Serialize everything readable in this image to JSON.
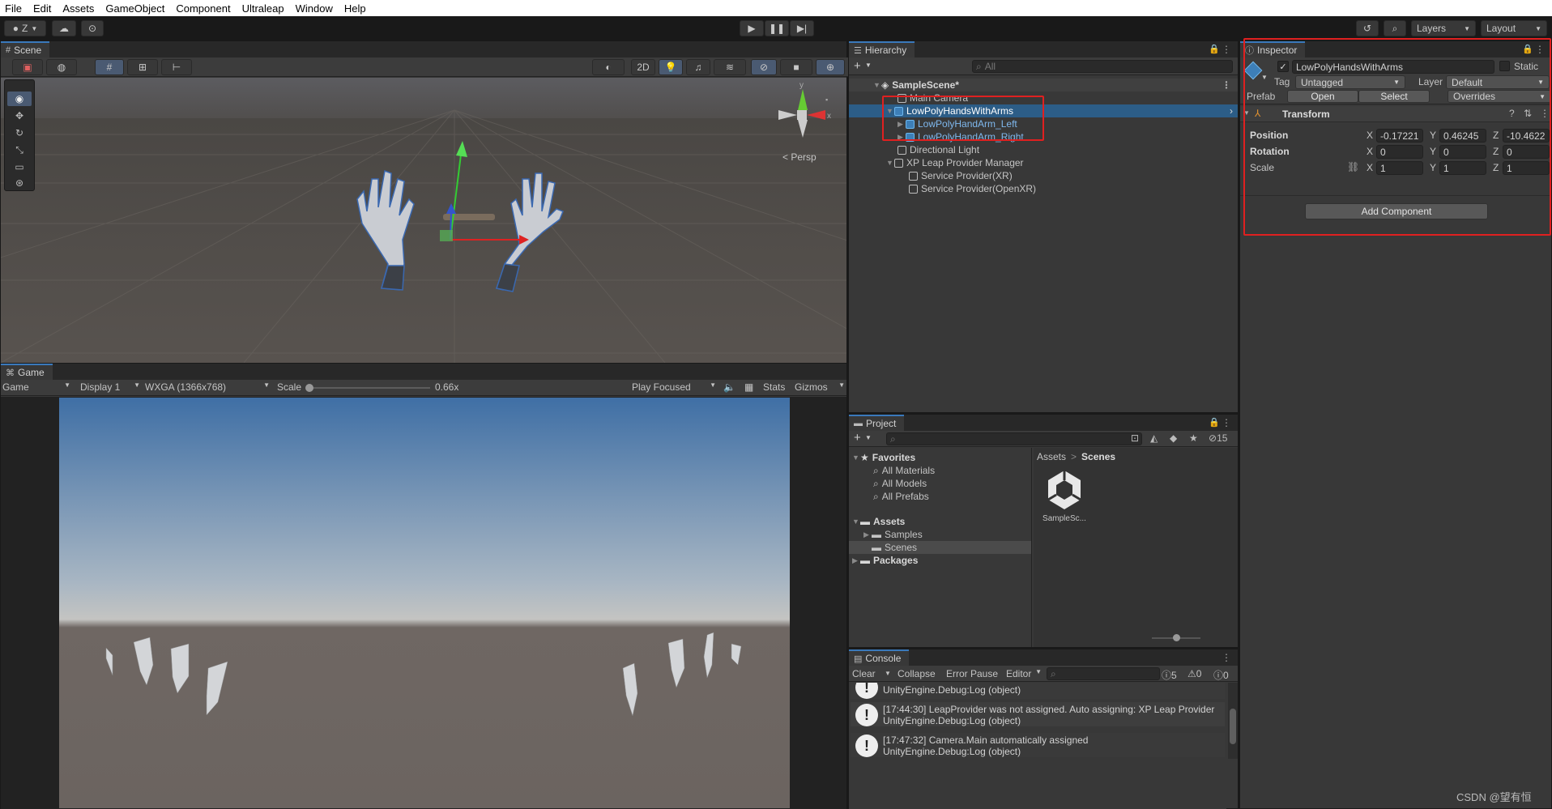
{
  "menu": [
    "File",
    "Edit",
    "Assets",
    "GameObject",
    "Component",
    "Ultraleap",
    "Window",
    "Help"
  ],
  "toolbar": {
    "account_label": "Z",
    "layers_label": "Layers",
    "layout_label": "Layout"
  },
  "scene": {
    "tab_label": "Scene",
    "persp_label": "< Persp",
    "view_2d": "2D",
    "gizmo_axes": {
      "x": "x",
      "y": "y"
    }
  },
  "game": {
    "tab_label": "Game",
    "game_dropdown": "Game",
    "display": "Display 1",
    "resolution": "WXGA (1366x768)",
    "scale_label": "Scale",
    "scale_value": "0.66x",
    "scale_fraction": 0.0,
    "play_focused": "Play Focused",
    "stats": "Stats",
    "gizmos": "Gizmos"
  },
  "hierarchy": {
    "tab_label": "Hierarchy",
    "search_placeholder": "All",
    "items": [
      {
        "label": "SampleScene*",
        "depth": 0,
        "type": "scene"
      },
      {
        "label": "Main Camera",
        "depth": 1,
        "type": "object"
      },
      {
        "label": "LowPolyHandsWithArms",
        "depth": 1,
        "type": "prefab",
        "selected": true
      },
      {
        "label": "LowPolyHandArm_Left",
        "depth": 2,
        "type": "prefab"
      },
      {
        "label": "LowPolyHandArm_Right",
        "depth": 2,
        "type": "prefab"
      },
      {
        "label": "Directional Light",
        "depth": 1,
        "type": "object"
      },
      {
        "label": "XP Leap Provider Manager",
        "depth": 1,
        "type": "object"
      },
      {
        "label": "Service Provider(XR)",
        "depth": 2,
        "type": "object"
      },
      {
        "label": "Service Provider(OpenXR)",
        "depth": 2,
        "type": "object"
      }
    ]
  },
  "inspector": {
    "tab_label": "Inspector",
    "object_name": "LowPolyHandsWithArms",
    "static_label": "Static",
    "tag_label": "Tag",
    "tag_value": "Untagged",
    "layer_label": "Layer",
    "layer_value": "Default",
    "prefab_label": "Prefab",
    "open_label": "Open",
    "select_label": "Select",
    "overrides_label": "Overrides",
    "transform_label": "Transform",
    "position_label": "Position",
    "pos_x": "-0.17221",
    "pos_y": "0.46245",
    "pos_z": "-10.4622",
    "rotation_label": "Rotation",
    "rot_x": "0",
    "rot_y": "0",
    "rot_z": "0",
    "scale_label": "Scale",
    "scale_x": "1",
    "scale_y": "1",
    "scale_z": "1",
    "axis_x": "X",
    "axis_y": "Y",
    "axis_z": "Z",
    "add_component": "Add Component"
  },
  "project": {
    "tab_label": "Project",
    "badge": "15",
    "favorites": "Favorites",
    "fav_items": [
      "All Materials",
      "All Models",
      "All Prefabs"
    ],
    "assets": "Assets",
    "asset_items": [
      "Samples",
      "Scenes"
    ],
    "packages": "Packages",
    "breadcrumb": [
      "Assets",
      "Scenes"
    ],
    "breadcrumb_sep": ">",
    "file_label": "SampleSc..."
  },
  "console": {
    "tab_label": "Console",
    "clear": "Clear",
    "collapse": "Collapse",
    "error_pause": "Error Pause",
    "editor": "Editor",
    "count_info": "5",
    "count_warn": "0",
    "count_err": "0",
    "partial_line": "UnityEngine.Debug:Log (object)",
    "messages": [
      {
        "line1": "[17:44:30] LeapProvider was not assigned. Auto assigning: XP Leap Provider",
        "line2": "UnityEngine.Debug:Log (object)"
      },
      {
        "line1": "[17:47:32] Camera.Main automatically assigned",
        "line2": "UnityEngine.Debug:Log (object)"
      }
    ]
  },
  "watermark": "CSDN @望有恒",
  "colors": {
    "accent": "#3a79bb",
    "highlight": "#2c5d87",
    "annotation": "#e02020"
  }
}
